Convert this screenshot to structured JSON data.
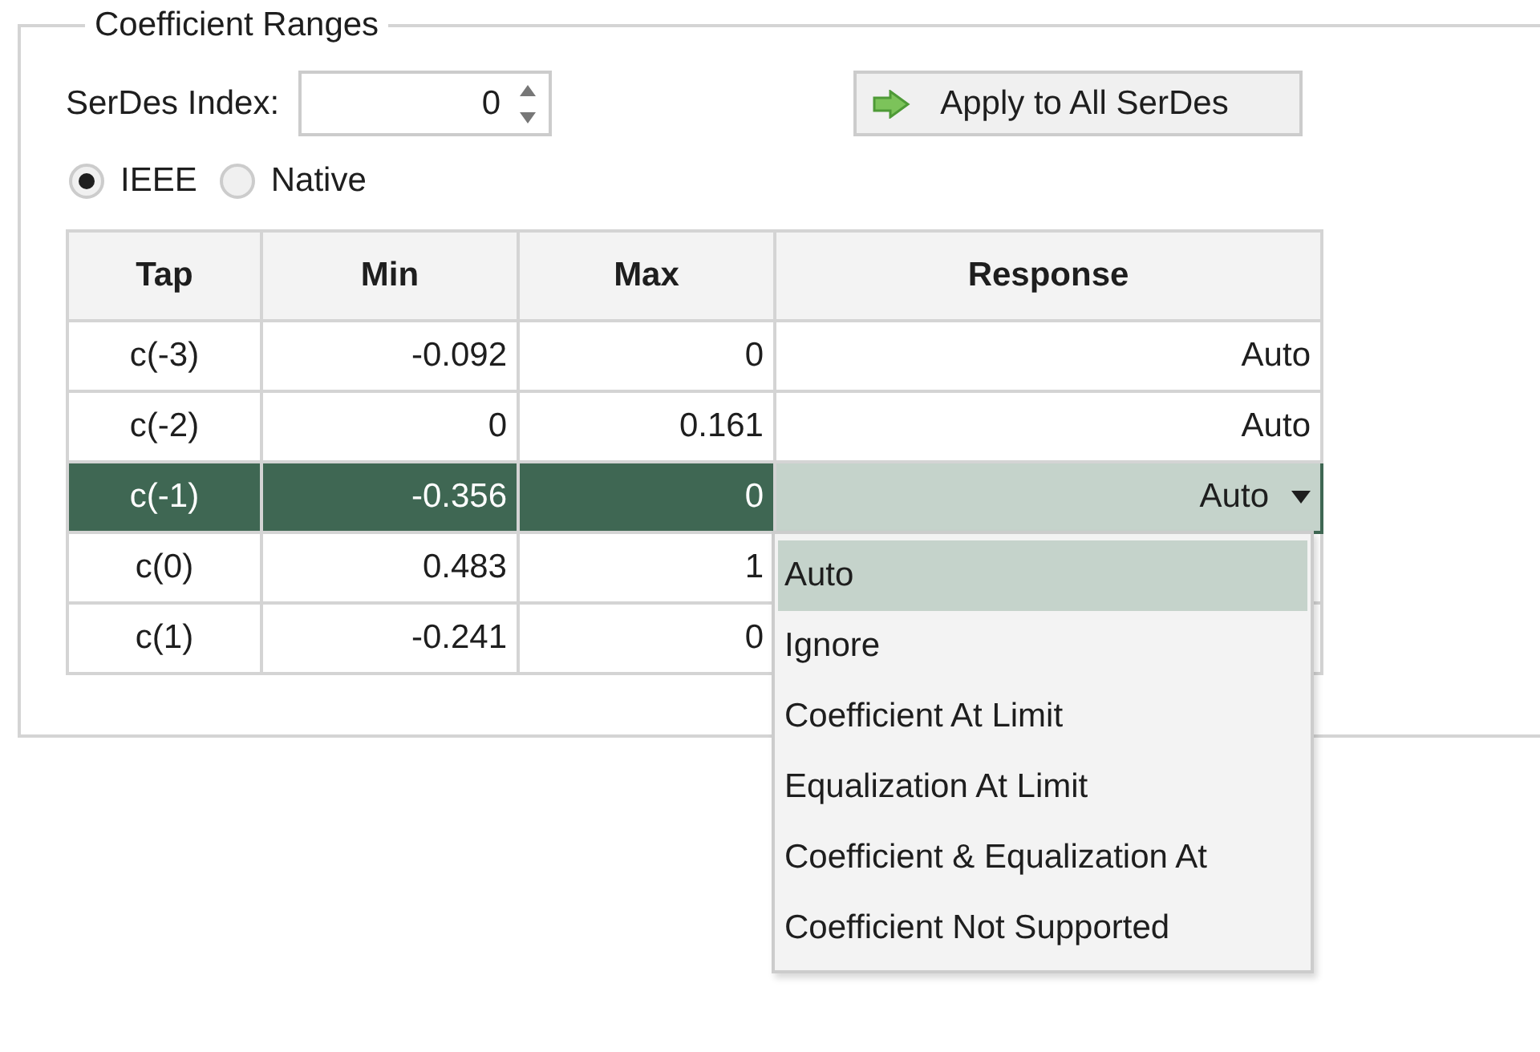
{
  "group": {
    "title": "Coefficient Ranges"
  },
  "serdes_index": {
    "label": "SerDes Index:",
    "value": "0"
  },
  "apply_button": {
    "label": "Apply to All SerDes"
  },
  "modes": [
    {
      "label": "IEEE",
      "selected": true
    },
    {
      "label": "Native",
      "selected": false
    }
  ],
  "table": {
    "columns": [
      "Tap",
      "Min",
      "Max",
      "Response"
    ],
    "rows": [
      {
        "tap": "c(-3)",
        "min": "-0.092",
        "max": "0",
        "response": "Auto",
        "selected": false,
        "expanded": false
      },
      {
        "tap": "c(-2)",
        "min": "0",
        "max": "0.161",
        "response": "Auto",
        "selected": false,
        "expanded": false
      },
      {
        "tap": "c(-1)",
        "min": "-0.356",
        "max": "0",
        "response": "Auto",
        "selected": true,
        "expanded": true,
        "options": [
          {
            "label": "Auto",
            "selected": true
          },
          {
            "label": "Ignore",
            "selected": false
          },
          {
            "label": "Coefficient At Limit",
            "selected": false
          },
          {
            "label": "Equalization At Limit",
            "selected": false
          },
          {
            "label": "Coefficient & Equalization At",
            "selected": false
          },
          {
            "label": "Coefficient Not Supported",
            "selected": false
          }
        ]
      },
      {
        "tap": "c(0)",
        "min": "0.483",
        "max": "1",
        "selected": false,
        "expanded": false
      },
      {
        "tap": "c(1)",
        "min": "-0.241",
        "max": "0",
        "selected": false,
        "expanded": false
      }
    ]
  }
}
